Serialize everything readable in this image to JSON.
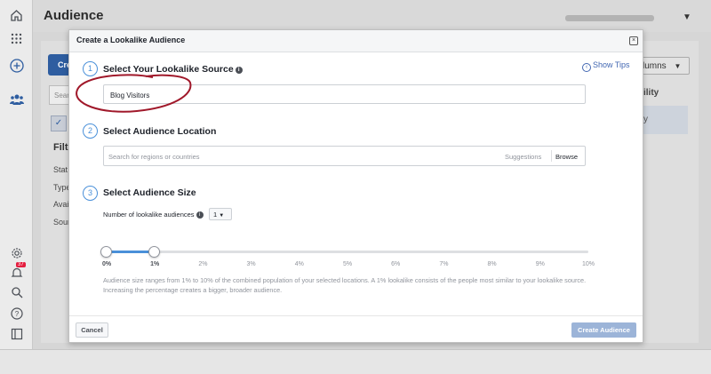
{
  "app": {
    "title": "Audience",
    "create_button_label": "Cre",
    "search_placeholder": "Sear",
    "filters_heading": "Filte",
    "filter_items": [
      "Stat",
      "Type",
      "Avai",
      "Sour"
    ],
    "columns_label": "lumns",
    "column_header": "ility",
    "row_value": "y",
    "notification_count": "37"
  },
  "modal": {
    "title": "Create a Lookalike Audience",
    "show_tips_label": "Show Tips",
    "steps": [
      {
        "number": "1",
        "title": "Select Your Lookalike Source"
      },
      {
        "number": "2",
        "title": "Select Audience Location"
      },
      {
        "number": "3",
        "title": "Select Audience Size"
      }
    ],
    "source_value": "Blog Visitors",
    "location_placeholder": "Search for regions or countries",
    "suggestions_label": "Suggestions",
    "browse_label": "Browse",
    "num_audiences_label": "Number of lookalike audiences",
    "num_audiences_value": "1",
    "slider_ticks": [
      "0%",
      "1%",
      "2%",
      "3%",
      "4%",
      "5%",
      "6%",
      "7%",
      "8%",
      "9%",
      "10%"
    ],
    "slider_range": [
      0,
      1
    ],
    "size_help": "Audience size ranges from 1% to 10% of the combined population of your selected locations. A 1% lookalike consists of the people most similar to your lookalike source. Increasing the percentage creates a bigger, broader audience.",
    "cancel_label": "Cancel",
    "create_label": "Create Audience"
  },
  "colors": {
    "accent": "#4a90d9",
    "link": "#4267b2",
    "create_disabled": "#9cb4d8",
    "annotation": "#a0182a"
  }
}
